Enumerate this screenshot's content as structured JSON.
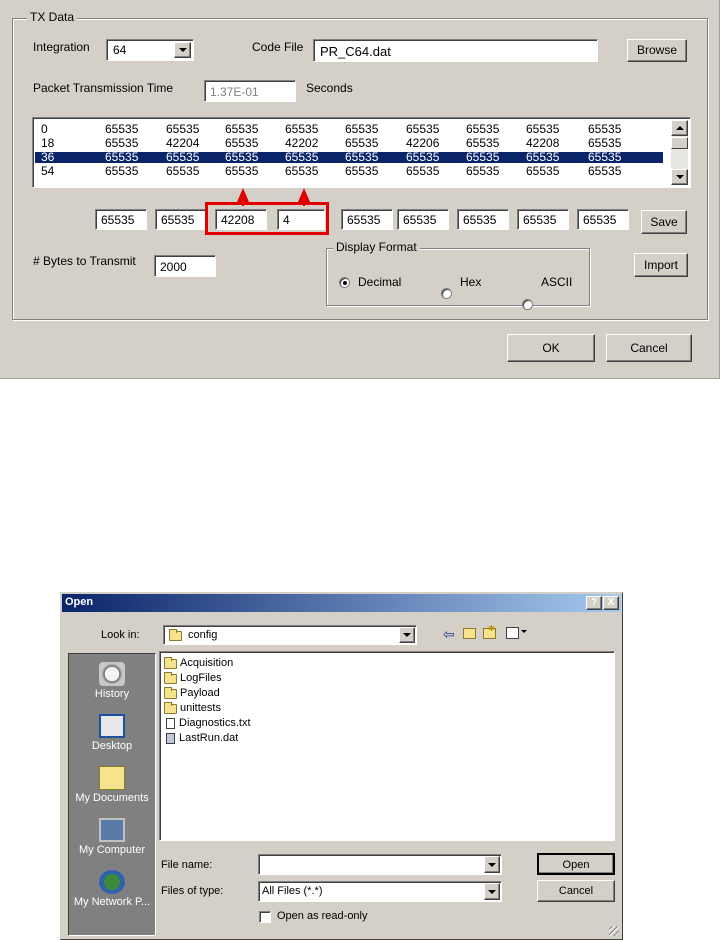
{
  "tx": {
    "group_title": "TX Data",
    "integration_label": "Integration",
    "integration_value": "64",
    "code_file_label": "Code File",
    "code_file_value": "PR_C64.dat",
    "browse_label": "Browse",
    "packet_time_label": "Packet Transmission Time",
    "packet_time_value": "1.37E-01",
    "seconds_label": "Seconds",
    "table_rows": [
      {
        "index": "0",
        "values": [
          "65535",
          "65535",
          "65535",
          "65535",
          "65535",
          "65535",
          "65535",
          "65535",
          "65535"
        ]
      },
      {
        "index": "18",
        "values": [
          "65535",
          "42204",
          "65535",
          "42202",
          "65535",
          "42206",
          "65535",
          "42208",
          "65535"
        ]
      },
      {
        "index": "36",
        "values": [
          "65535",
          "65535",
          "65535",
          "65535",
          "65535",
          "65535",
          "65535",
          "65535",
          "65535"
        ],
        "selected": true
      },
      {
        "index": "54",
        "values": [
          "65535",
          "65535",
          "65535",
          "65535",
          "65535",
          "65535",
          "65535",
          "65535",
          "65535"
        ]
      }
    ],
    "edit_fields": [
      "65535",
      "65535",
      "42208",
      "4",
      "65535",
      "65535",
      "65535",
      "65535",
      "65535"
    ],
    "save_label": "Save",
    "bytes_label": "# Bytes to Transmit",
    "bytes_value": "2000",
    "display_format_title": "Display Format",
    "format_options": [
      "Decimal",
      "Hex",
      "ASCII"
    ],
    "format_selected": "Decimal",
    "import_label": "Import",
    "ok_label": "OK",
    "cancel_label": "Cancel",
    "highlight_color": "#e00000"
  },
  "open_dialog": {
    "title": "Open",
    "help_glyph": "?",
    "close_glyph": "X",
    "look_in_label": "Look in:",
    "look_in_value": "config",
    "places": [
      "History",
      "Desktop",
      "My Documents",
      "My Computer",
      "My Network P..."
    ],
    "files": [
      {
        "name": "Acquisition",
        "kind": "folder"
      },
      {
        "name": "LogFiles",
        "kind": "folder"
      },
      {
        "name": "Payload",
        "kind": "folder"
      },
      {
        "name": "unittests",
        "kind": "folder"
      },
      {
        "name": "Diagnostics.txt",
        "kind": "text"
      },
      {
        "name": "LastRun.dat",
        "kind": "data"
      }
    ],
    "file_name_label": "File name:",
    "file_name_value": "",
    "files_of_type_label": "Files of type:",
    "files_of_type_value": "All Files (*.*)",
    "open_label": "Open",
    "cancel_label": "Cancel",
    "readonly_label": "Open as read-only"
  }
}
